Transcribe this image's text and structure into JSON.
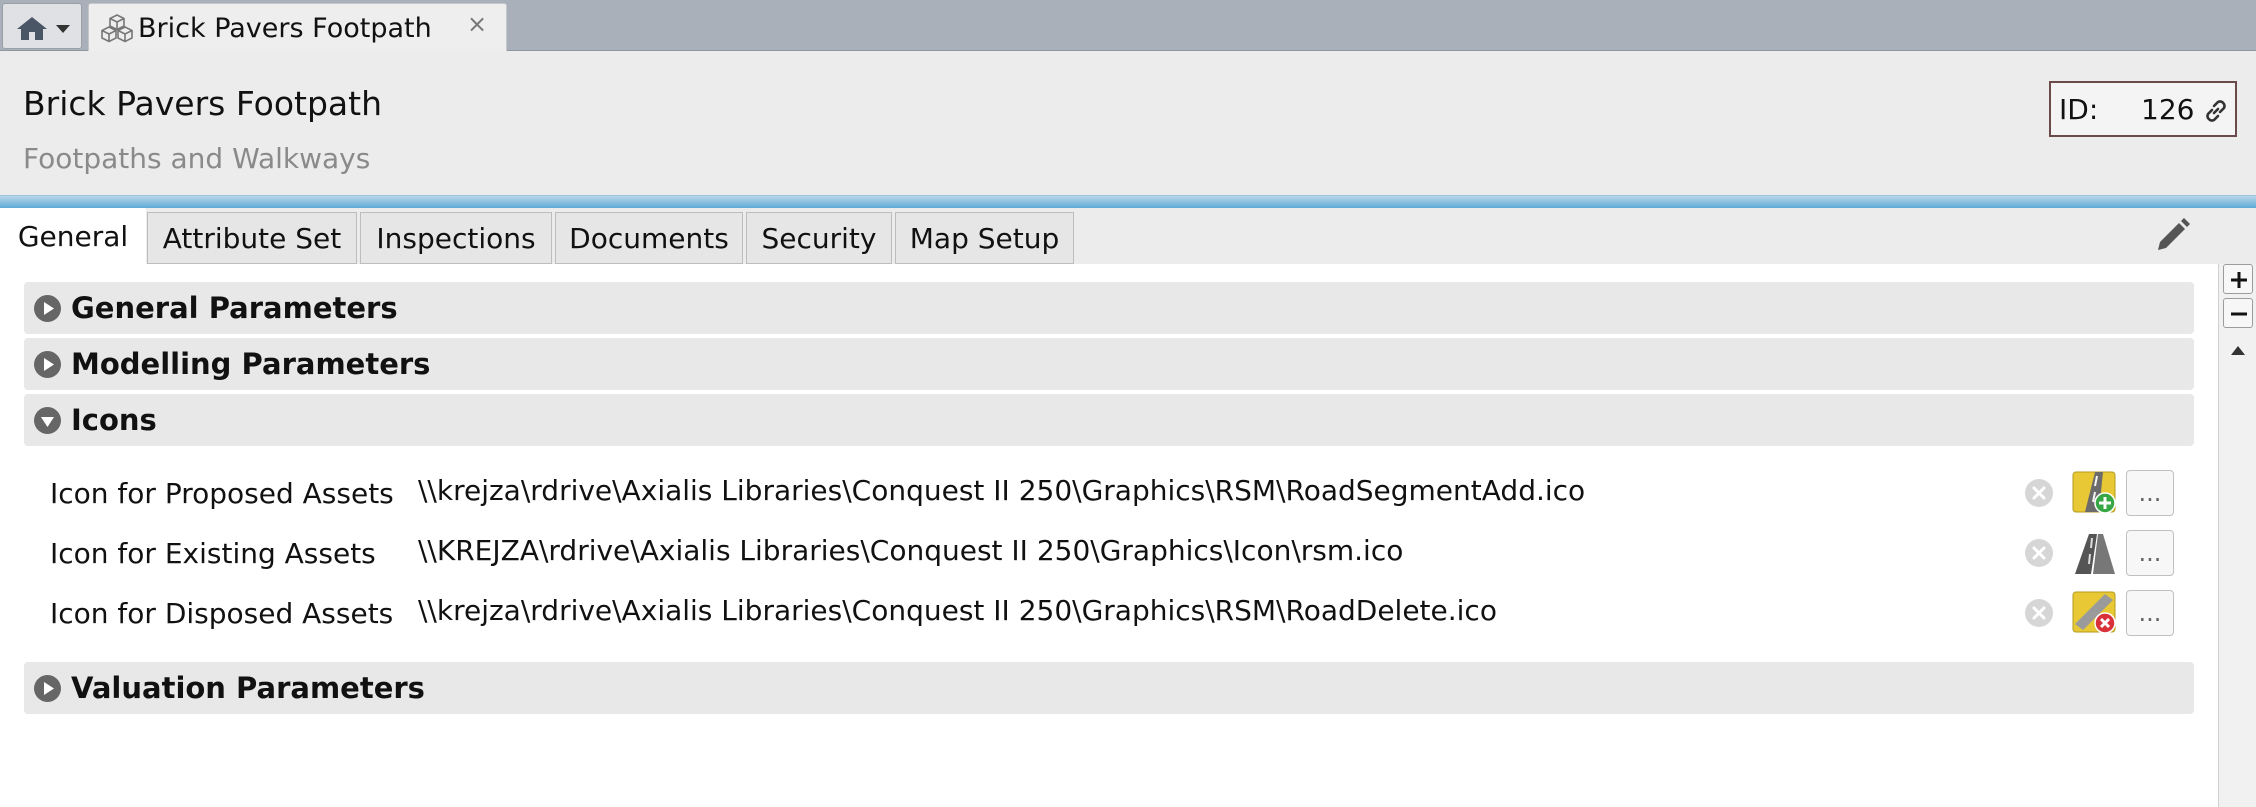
{
  "window": {
    "tab_title": "Brick Pavers Footpath",
    "tab_close": "×"
  },
  "header": {
    "title": "Brick Pavers Footpath",
    "subtitle": "Footpaths and Walkways",
    "id_label": "ID:",
    "id_value": "126"
  },
  "tabs": [
    {
      "label": "General",
      "active": true
    },
    {
      "label": "Attribute Set",
      "active": false
    },
    {
      "label": "Inspections",
      "active": false
    },
    {
      "label": "Documents",
      "active": false
    },
    {
      "label": "Security",
      "active": false
    },
    {
      "label": "Map Setup",
      "active": false
    }
  ],
  "sections": [
    {
      "title": "General Parameters",
      "expanded": false
    },
    {
      "title": "Modelling Parameters",
      "expanded": false
    },
    {
      "title": "Icons",
      "expanded": true
    },
    {
      "title": "Valuation Parameters",
      "expanded": false
    }
  ],
  "icons": {
    "rows": [
      {
        "label": "Icon for Proposed Assets",
        "path": "\\\\krejza\\rdrive\\Axialis Libraries\\Conquest II 250\\Graphics\\RSM\\RoadSegmentAdd.ico",
        "icon": "road-segment-add-icon",
        "browse": "..."
      },
      {
        "label": "Icon for Existing Assets",
        "path": "\\\\KREJZA\\rdrive\\Axialis Libraries\\Conquest II 250\\Graphics\\Icon\\rsm.ico",
        "icon": "road-icon",
        "browse": "..."
      },
      {
        "label": "Icon for Disposed Assets",
        "path": "\\\\krejza\\rdrive\\Axialis Libraries\\Conquest II 250\\Graphics\\RSM\\RoadDelete.ico",
        "icon": "road-delete-icon",
        "browse": "..."
      }
    ]
  },
  "colors": {
    "accent_blue": "#5fa9d6",
    "section_bg": "#e7e8e7",
    "tabstrip_bg": "#a9b0ba"
  }
}
